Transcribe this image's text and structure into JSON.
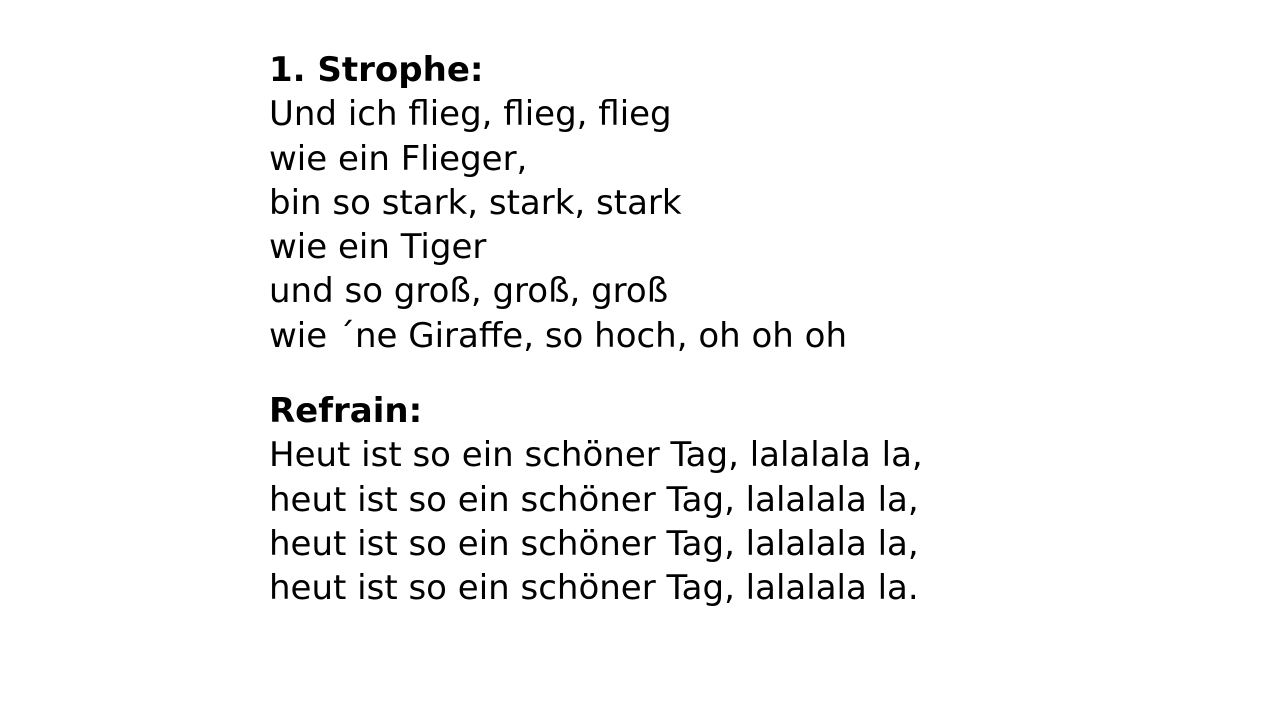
{
  "verse": {
    "heading": "1. Strophe:",
    "lines": [
      "Und ich flieg, flieg, flieg",
      "wie ein Flieger,",
      "bin so stark, stark, stark",
      "wie ein Tiger",
      "und so groß, groß, groß",
      "wie ´ne Giraffe, so hoch, oh oh oh"
    ]
  },
  "refrain": {
    "heading": "Refrain:",
    "lines": [
      "Heut ist so ein schöner Tag, lalalala la,",
      "heut ist so ein schöner Tag, lalalala la,",
      "heut ist so ein schöner Tag, lalalala la,",
      "heut ist so ein schöner Tag, lalalala la."
    ]
  }
}
